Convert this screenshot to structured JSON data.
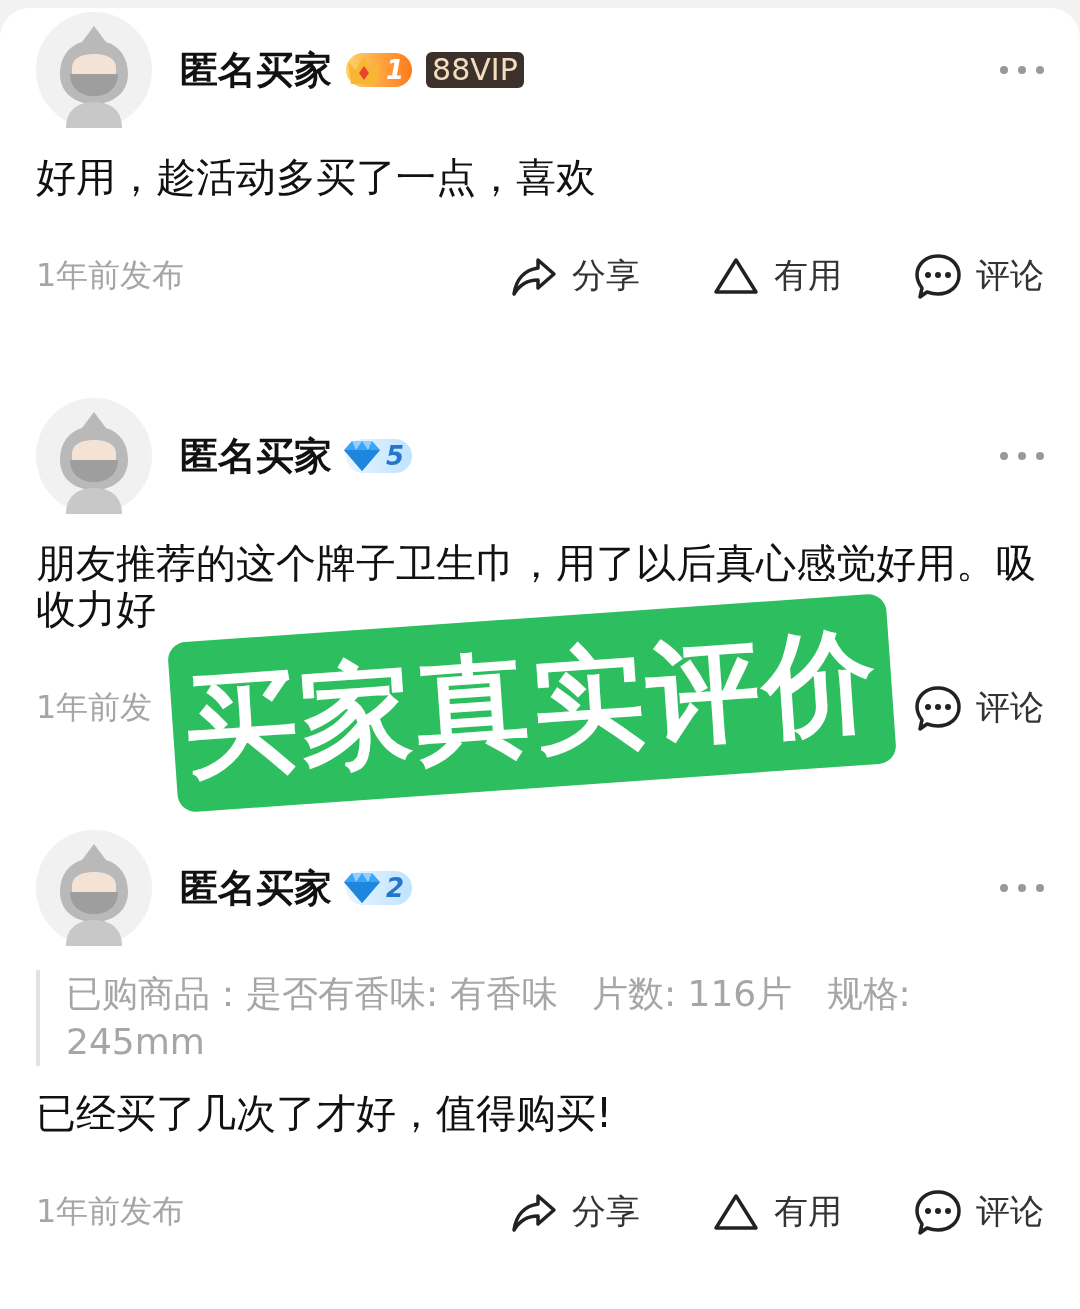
{
  "reviews": [
    {
      "author": "匿名买家",
      "level_badge": {
        "kind": "crown",
        "number": "1"
      },
      "vip_badge": "88VIP",
      "text": "好用，趁活动多买了一点，喜欢",
      "time": "1年前发布",
      "actions": [
        {
          "kind": "share",
          "label": "分享"
        },
        {
          "kind": "useful",
          "label": "有用"
        },
        {
          "kind": "comment",
          "label": "评论"
        }
      ]
    },
    {
      "author": "匿名买家",
      "level_badge": {
        "kind": "diamond",
        "number": "5"
      },
      "text": "朋友推荐的这个牌子卫生巾，用了以后真心感觉好用。吸收力好",
      "time": "1年前发",
      "actions": [
        {
          "kind": "comment",
          "label": "评论"
        }
      ],
      "sticker": {
        "text": "买家真实评价"
      }
    },
    {
      "author": "匿名买家",
      "level_badge": {
        "kind": "diamond",
        "number": "2"
      },
      "purchase_info": "已购商品：是否有香味: 有香味   片数: 116片   规格: 245mm",
      "text": "已经买了几次了才好，值得购买!",
      "time": "1年前发布",
      "actions": [
        {
          "kind": "share",
          "label": "分享"
        },
        {
          "kind": "useful",
          "label": "有用"
        },
        {
          "kind": "comment",
          "label": "评论"
        }
      ]
    }
  ]
}
